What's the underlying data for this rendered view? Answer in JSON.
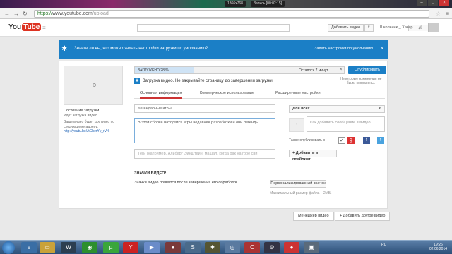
{
  "screen_recorder": {
    "resolution": "1366x768",
    "recording": "Запись [00:02:15]"
  },
  "browser": {
    "url_scheme": "https://",
    "url_host": "www.youtube.com",
    "url_path": "/upload"
  },
  "header": {
    "logo_you": "You",
    "logo_tube": "Tube",
    "search_placeholder": "",
    "add_video": "Добавить видео",
    "user_name": "Школьник _ Хакер"
  },
  "banner": {
    "text": "Знаете ли вы, что можно задать настройки загрузки по умолчанию?",
    "link": "Задать настройки по умолчанию"
  },
  "sidebar": {
    "status_heading": "Состояние загрузки",
    "status_text": "Идет загрузка видео...",
    "available_text": "Ваше видео будет доступно по следующему адресу:",
    "video_link": "http://youtu.be/AGherYy_rVrk"
  },
  "upload": {
    "progress_label": "ЗАГРУЖЕНО 28 %",
    "progress_fraction": 0.28,
    "time_left": "Осталось 7 минут.",
    "publish": "Опубликовать",
    "unsaved": "Некоторые изменения не были сохранены.",
    "warning": "Загрузка видео. Не закрывайте страницу до завершения загрузки."
  },
  "tabs": [
    {
      "label": "Основная информация"
    },
    {
      "label": "Коммерческое использование"
    },
    {
      "label": "Расширенные настройки"
    }
  ],
  "form": {
    "title": "Легендарные игры",
    "description": "В этой сборке находятся игры недавней разработки и они легенды",
    "tags_placeholder": "Теги (например, Альберт Эйнштейн, машал, когда рак на горе сви",
    "privacy": "Для всех",
    "message_placeholder": "Как добавить сообщение в видео",
    "share_label": "Также опубликовать в",
    "add_playlist": "+ Добавить в плейлист"
  },
  "icons": {
    "heading": "ЗНАЧКИ ВИДЕО",
    "text": "Значки видео появятся после завершения его обработки.",
    "custom_button": "Персонализированный значок",
    "custom_note": "Максимальный размер файла – 2МБ."
  },
  "bottom": {
    "manager": "Менеджер видео",
    "add_another": "+ Добавить другое видео"
  },
  "taskbar": {
    "lang": "RU",
    "time": "19:26",
    "date": "02.06.2014"
  }
}
